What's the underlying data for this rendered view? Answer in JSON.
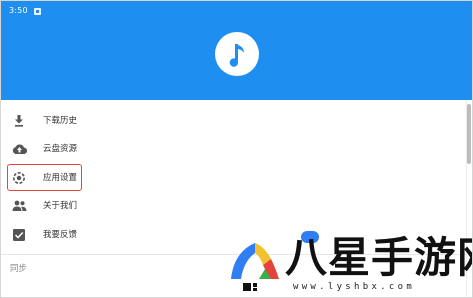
{
  "status_bar": {
    "time": "3:50",
    "notification_icon": "notification-square-icon"
  },
  "header": {
    "logo_icon": "music-note-icon",
    "background_color": "#1e8ff0"
  },
  "menu": {
    "items": [
      {
        "label": "下载历史",
        "icon": "download-icon"
      },
      {
        "label": "云盘资源",
        "icon": "cloud-upload-icon"
      },
      {
        "label": "应用设置",
        "icon": "settings-icon",
        "highlighted": true
      },
      {
        "label": "关于我们",
        "icon": "people-icon"
      },
      {
        "label": "我要反馈",
        "icon": "feedback-icon"
      }
    ],
    "highlight_color": "#e3443b"
  },
  "section": {
    "label": "同步"
  },
  "watermark": {
    "text": "八星手游网",
    "url": "www.lyshbx.com",
    "logo_colors": [
      "#2f7ef2",
      "#f2c12e",
      "#e3443b",
      "#35b34a"
    ]
  }
}
